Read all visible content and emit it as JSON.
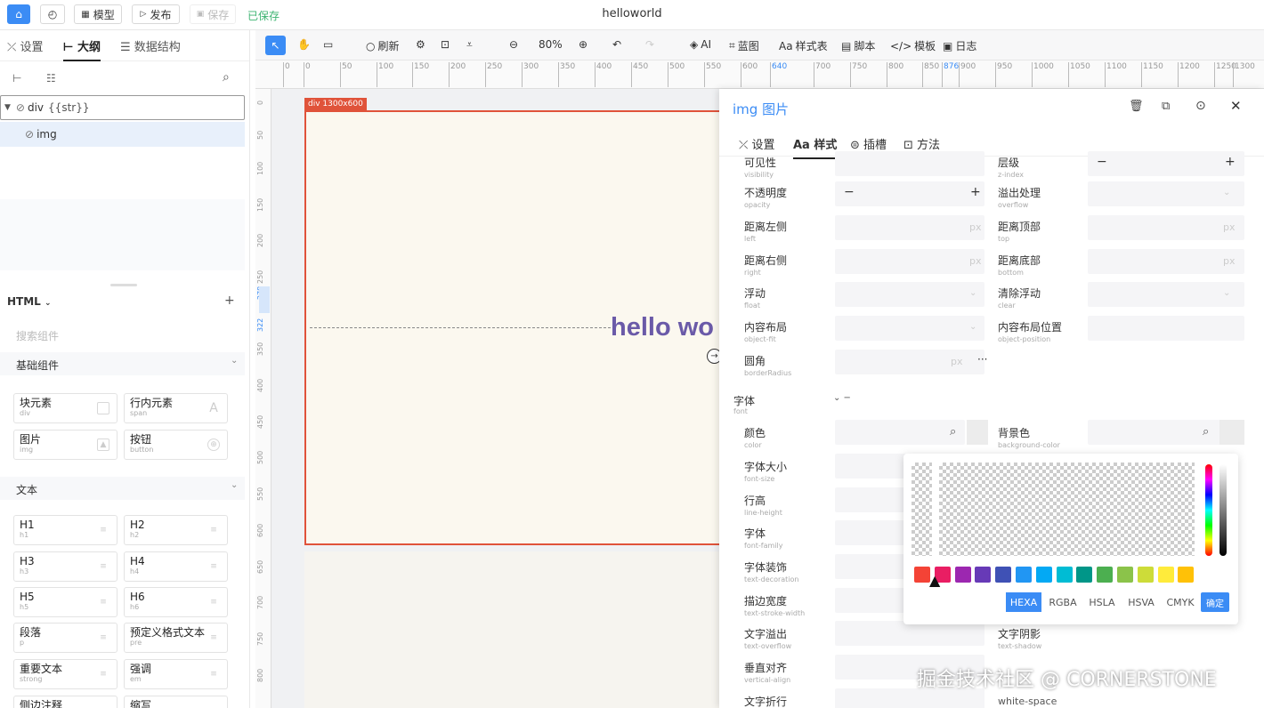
{
  "app": {
    "title": "helloworld",
    "model_label": "模型",
    "publish_label": "发布",
    "save_label": "保存",
    "saved_status": "已保存"
  },
  "left": {
    "tabs": [
      "设置",
      "大纲",
      "数据结构"
    ],
    "tree": [
      {
        "label": "div",
        "extra": "{{str}}"
      },
      {
        "label": "img"
      }
    ],
    "html_section": "HTML",
    "search_placeholder": "搜索组件",
    "basic_group": "基础组件",
    "basic_items": [
      {
        "title": "块元素",
        "tag": "div"
      },
      {
        "title": "行内元素",
        "tag": "span"
      },
      {
        "title": "图片",
        "tag": "img"
      },
      {
        "title": "按钮",
        "tag": "button"
      }
    ],
    "text_group": "文本",
    "text_items": [
      {
        "title": "H1",
        "tag": "h1"
      },
      {
        "title": "H2",
        "tag": "h2"
      },
      {
        "title": "H3",
        "tag": "h3"
      },
      {
        "title": "H4",
        "tag": "h4"
      },
      {
        "title": "H5",
        "tag": "h5"
      },
      {
        "title": "H6",
        "tag": "h6"
      },
      {
        "title": "段落",
        "tag": "p"
      },
      {
        "title": "预定义格式文本",
        "tag": "pre"
      },
      {
        "title": "重要文本",
        "tag": "strong"
      },
      {
        "title": "强调",
        "tag": "em"
      },
      {
        "title": "侧边注释",
        "tag": ""
      },
      {
        "title": "缩写",
        "tag": ""
      }
    ]
  },
  "toolbar": {
    "refresh": "刷新",
    "zoom": "80%",
    "ai": "AI",
    "blueprint": "蓝图",
    "stylesheet": "样式表",
    "script": "脚本",
    "template": "模板",
    "log": "日志"
  },
  "ruler": {
    "h_ticks": [
      "0",
      "0",
      "50",
      "100",
      "150",
      "200",
      "250",
      "300",
      "350",
      "400",
      "450",
      "500",
      "550",
      "600",
      "640",
      "700",
      "750",
      "800",
      "850",
      "876",
      "900",
      "950",
      "1000",
      "1050",
      "1100",
      "1150",
      "1200",
      "1250",
      "1300"
    ],
    "v_ticks": [
      "0",
      "50",
      "100",
      "150",
      "200",
      "250",
      "278",
      "322",
      "350",
      "400",
      "450",
      "500",
      "550",
      "600",
      "650",
      "700",
      "750",
      "800"
    ]
  },
  "canvas": {
    "frame_tag": "div 1300x600",
    "hello_text": "hello wo"
  },
  "panel": {
    "title": "img 图片",
    "tabs": [
      "设置",
      "样式",
      "插槽",
      "方法"
    ],
    "rows": [
      {
        "l": "可见性",
        "ls": "visibility",
        "r": "层级",
        "rs": "z-index"
      },
      {
        "l": "不透明度",
        "ls": "opacity",
        "r": "溢出处理",
        "rs": "overflow"
      },
      {
        "l": "距离左侧",
        "ls": "left",
        "r": "距离顶部",
        "rs": "top"
      },
      {
        "l": "距离右侧",
        "ls": "right",
        "r": "距离底部",
        "rs": "bottom"
      },
      {
        "l": "浮动",
        "ls": "float",
        "r": "清除浮动",
        "rs": "clear"
      },
      {
        "l": "内容布局",
        "ls": "object-fit",
        "r": "内容布局位置",
        "rs": "object-position"
      },
      {
        "l": "圆角",
        "ls": "borderRadius",
        "r": "",
        "rs": ""
      }
    ],
    "px": "px",
    "font_section": "字体",
    "font_section_sub": "font",
    "font_rows": [
      {
        "l": "颜色",
        "ls": "color"
      },
      {
        "l": "字体大小",
        "ls": "font-size"
      },
      {
        "l": "行高",
        "ls": "line-height"
      },
      {
        "l": "字体",
        "ls": "font-family"
      },
      {
        "l": "字体装饰",
        "ls": "text-decoration"
      },
      {
        "l": "描边宽度",
        "ls": "text-stroke-width"
      },
      {
        "l": "文字溢出",
        "ls": "text-overflow"
      },
      {
        "l": "垂直对齐",
        "ls": "vertical-align"
      },
      {
        "l": "文字折行",
        "ls": ""
      }
    ],
    "bg_color": {
      "l": "背景色",
      "ls": "background-color"
    },
    "text_shadow": {
      "l": "文字阴影",
      "ls": "text-shadow"
    },
    "white_space": "white-space",
    "picker": {
      "formats": [
        "HEXA",
        "RGBA",
        "HSLA",
        "HSVA",
        "CMYK"
      ],
      "confirm": "确定",
      "swatches": [
        "#f44336",
        "#e91e63",
        "#9c27b0",
        "#673ab7",
        "#3f51b5",
        "#2196f3",
        "#03a9f4",
        "#00bcd4",
        "#009688",
        "#4caf50",
        "#8bc34a",
        "#cddc39",
        "#ffeb3b",
        "#ffc107"
      ]
    }
  },
  "watermark": "掘金技术社区 @ CORNERSTONE",
  "colors": {
    "accent": "#3b8cf5",
    "frame": "#e0533a",
    "hello": "#6a5aa8"
  }
}
